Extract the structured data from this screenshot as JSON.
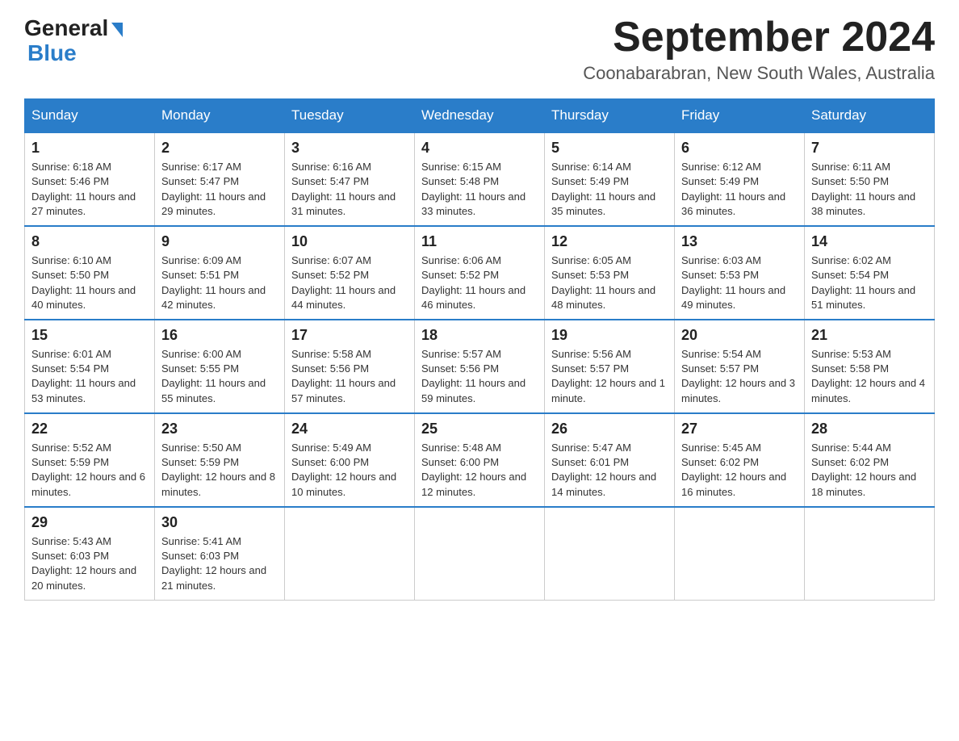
{
  "logo": {
    "general": "General",
    "blue": "Blue"
  },
  "title": {
    "month_year": "September 2024",
    "location": "Coonabarabran, New South Wales, Australia"
  },
  "days_of_week": [
    "Sunday",
    "Monday",
    "Tuesday",
    "Wednesday",
    "Thursday",
    "Friday",
    "Saturday"
  ],
  "weeks": [
    [
      {
        "day": "1",
        "sunrise": "Sunrise: 6:18 AM",
        "sunset": "Sunset: 5:46 PM",
        "daylight": "Daylight: 11 hours and 27 minutes."
      },
      {
        "day": "2",
        "sunrise": "Sunrise: 6:17 AM",
        "sunset": "Sunset: 5:47 PM",
        "daylight": "Daylight: 11 hours and 29 minutes."
      },
      {
        "day": "3",
        "sunrise": "Sunrise: 6:16 AM",
        "sunset": "Sunset: 5:47 PM",
        "daylight": "Daylight: 11 hours and 31 minutes."
      },
      {
        "day": "4",
        "sunrise": "Sunrise: 6:15 AM",
        "sunset": "Sunset: 5:48 PM",
        "daylight": "Daylight: 11 hours and 33 minutes."
      },
      {
        "day": "5",
        "sunrise": "Sunrise: 6:14 AM",
        "sunset": "Sunset: 5:49 PM",
        "daylight": "Daylight: 11 hours and 35 minutes."
      },
      {
        "day": "6",
        "sunrise": "Sunrise: 6:12 AM",
        "sunset": "Sunset: 5:49 PM",
        "daylight": "Daylight: 11 hours and 36 minutes."
      },
      {
        "day": "7",
        "sunrise": "Sunrise: 6:11 AM",
        "sunset": "Sunset: 5:50 PM",
        "daylight": "Daylight: 11 hours and 38 minutes."
      }
    ],
    [
      {
        "day": "8",
        "sunrise": "Sunrise: 6:10 AM",
        "sunset": "Sunset: 5:50 PM",
        "daylight": "Daylight: 11 hours and 40 minutes."
      },
      {
        "day": "9",
        "sunrise": "Sunrise: 6:09 AM",
        "sunset": "Sunset: 5:51 PM",
        "daylight": "Daylight: 11 hours and 42 minutes."
      },
      {
        "day": "10",
        "sunrise": "Sunrise: 6:07 AM",
        "sunset": "Sunset: 5:52 PM",
        "daylight": "Daylight: 11 hours and 44 minutes."
      },
      {
        "day": "11",
        "sunrise": "Sunrise: 6:06 AM",
        "sunset": "Sunset: 5:52 PM",
        "daylight": "Daylight: 11 hours and 46 minutes."
      },
      {
        "day": "12",
        "sunrise": "Sunrise: 6:05 AM",
        "sunset": "Sunset: 5:53 PM",
        "daylight": "Daylight: 11 hours and 48 minutes."
      },
      {
        "day": "13",
        "sunrise": "Sunrise: 6:03 AM",
        "sunset": "Sunset: 5:53 PM",
        "daylight": "Daylight: 11 hours and 49 minutes."
      },
      {
        "day": "14",
        "sunrise": "Sunrise: 6:02 AM",
        "sunset": "Sunset: 5:54 PM",
        "daylight": "Daylight: 11 hours and 51 minutes."
      }
    ],
    [
      {
        "day": "15",
        "sunrise": "Sunrise: 6:01 AM",
        "sunset": "Sunset: 5:54 PM",
        "daylight": "Daylight: 11 hours and 53 minutes."
      },
      {
        "day": "16",
        "sunrise": "Sunrise: 6:00 AM",
        "sunset": "Sunset: 5:55 PM",
        "daylight": "Daylight: 11 hours and 55 minutes."
      },
      {
        "day": "17",
        "sunrise": "Sunrise: 5:58 AM",
        "sunset": "Sunset: 5:56 PM",
        "daylight": "Daylight: 11 hours and 57 minutes."
      },
      {
        "day": "18",
        "sunrise": "Sunrise: 5:57 AM",
        "sunset": "Sunset: 5:56 PM",
        "daylight": "Daylight: 11 hours and 59 minutes."
      },
      {
        "day": "19",
        "sunrise": "Sunrise: 5:56 AM",
        "sunset": "Sunset: 5:57 PM",
        "daylight": "Daylight: 12 hours and 1 minute."
      },
      {
        "day": "20",
        "sunrise": "Sunrise: 5:54 AM",
        "sunset": "Sunset: 5:57 PM",
        "daylight": "Daylight: 12 hours and 3 minutes."
      },
      {
        "day": "21",
        "sunrise": "Sunrise: 5:53 AM",
        "sunset": "Sunset: 5:58 PM",
        "daylight": "Daylight: 12 hours and 4 minutes."
      }
    ],
    [
      {
        "day": "22",
        "sunrise": "Sunrise: 5:52 AM",
        "sunset": "Sunset: 5:59 PM",
        "daylight": "Daylight: 12 hours and 6 minutes."
      },
      {
        "day": "23",
        "sunrise": "Sunrise: 5:50 AM",
        "sunset": "Sunset: 5:59 PM",
        "daylight": "Daylight: 12 hours and 8 minutes."
      },
      {
        "day": "24",
        "sunrise": "Sunrise: 5:49 AM",
        "sunset": "Sunset: 6:00 PM",
        "daylight": "Daylight: 12 hours and 10 minutes."
      },
      {
        "day": "25",
        "sunrise": "Sunrise: 5:48 AM",
        "sunset": "Sunset: 6:00 PM",
        "daylight": "Daylight: 12 hours and 12 minutes."
      },
      {
        "day": "26",
        "sunrise": "Sunrise: 5:47 AM",
        "sunset": "Sunset: 6:01 PM",
        "daylight": "Daylight: 12 hours and 14 minutes."
      },
      {
        "day": "27",
        "sunrise": "Sunrise: 5:45 AM",
        "sunset": "Sunset: 6:02 PM",
        "daylight": "Daylight: 12 hours and 16 minutes."
      },
      {
        "day": "28",
        "sunrise": "Sunrise: 5:44 AM",
        "sunset": "Sunset: 6:02 PM",
        "daylight": "Daylight: 12 hours and 18 minutes."
      }
    ],
    [
      {
        "day": "29",
        "sunrise": "Sunrise: 5:43 AM",
        "sunset": "Sunset: 6:03 PM",
        "daylight": "Daylight: 12 hours and 20 minutes."
      },
      {
        "day": "30",
        "sunrise": "Sunrise: 5:41 AM",
        "sunset": "Sunset: 6:03 PM",
        "daylight": "Daylight: 12 hours and 21 minutes."
      },
      null,
      null,
      null,
      null,
      null
    ]
  ]
}
